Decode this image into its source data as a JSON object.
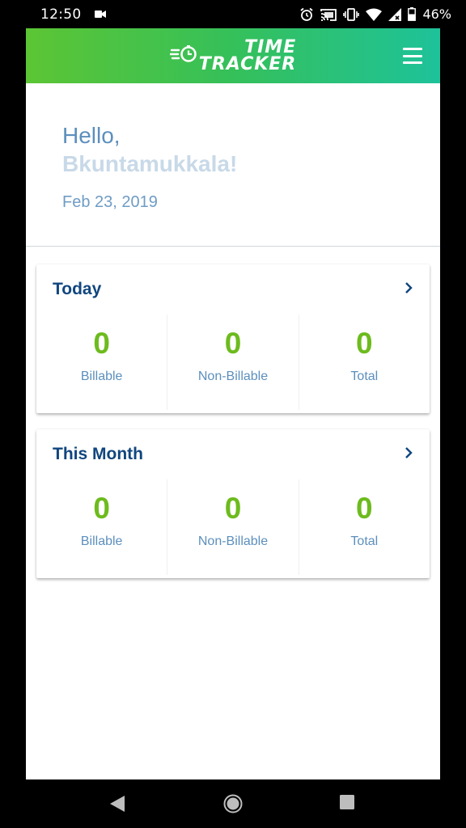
{
  "status_bar": {
    "time": "12:50",
    "battery_percent": "46%",
    "icons": [
      "video-icon",
      "alarm-icon",
      "cast-icon",
      "vibrate-icon",
      "wifi-icon",
      "signal-icon",
      "battery-icon"
    ]
  },
  "header": {
    "logo_line1": "TIME",
    "logo_line2": "TRACKER",
    "menu_icon": "hamburger-menu-icon",
    "gradient": [
      "#5cc534",
      "#1ec29a"
    ]
  },
  "greeting": {
    "hello": "Hello,",
    "name": "Bkuntamukkala!",
    "date": "Feb 23, 2019"
  },
  "cards": [
    {
      "title": "Today",
      "stats": [
        {
          "value": "0",
          "label": "Billable"
        },
        {
          "value": "0",
          "label": "Non-Billable"
        },
        {
          "value": "0",
          "label": "Total"
        }
      ]
    },
    {
      "title": "This Month",
      "stats": [
        {
          "value": "0",
          "label": "Billable"
        },
        {
          "value": "0",
          "label": "Non-Billable"
        },
        {
          "value": "0",
          "label": "Total"
        }
      ]
    }
  ],
  "colors": {
    "accent_green": "#6dbb1e",
    "title_blue": "#10467e",
    "label_blue": "#5c8fbd"
  },
  "nav_bar": {
    "icons": [
      "back-icon",
      "home-icon",
      "recents-icon"
    ]
  }
}
